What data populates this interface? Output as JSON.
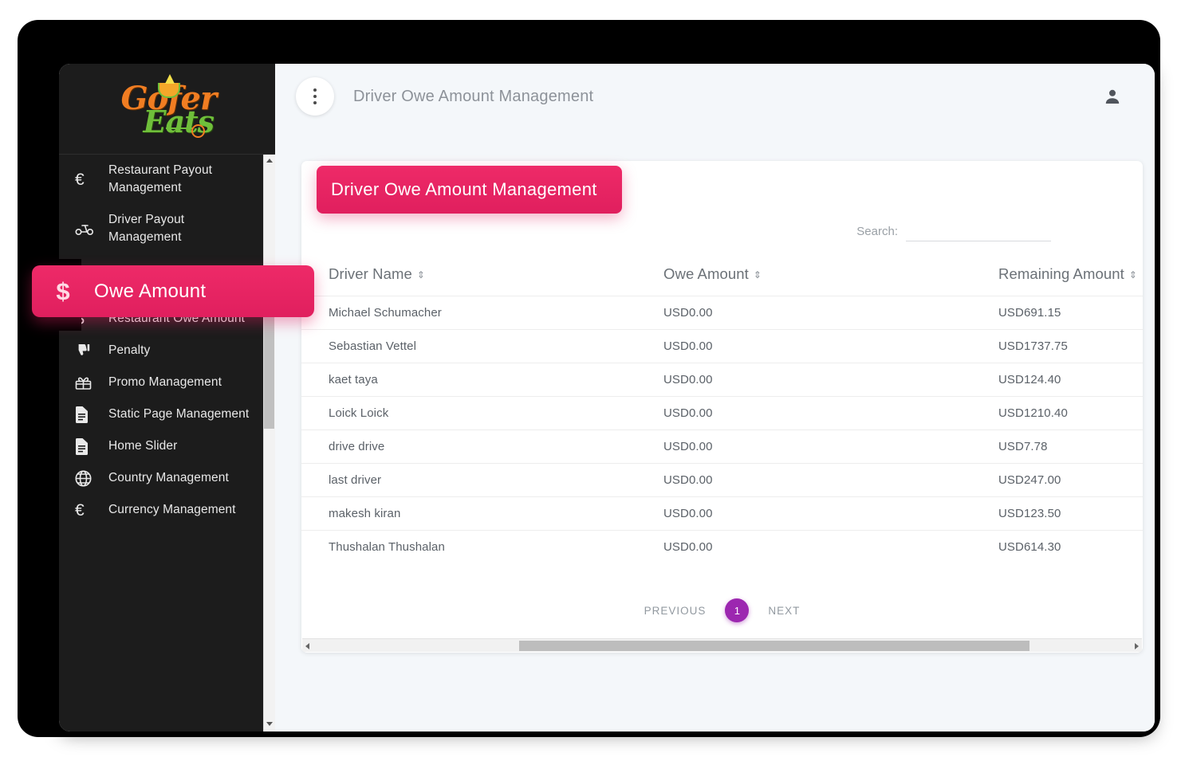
{
  "brand": {
    "logo_primary": "Gofer",
    "logo_secondary": "Eats",
    "accent_pink": "#e81f5e",
    "accent_purple": "#9c27b0",
    "sidebar_bg": "#1c1c1c"
  },
  "topbar": {
    "menu_icon": "kebab-menu-icon",
    "title": "Driver Owe Amount Management",
    "user_icon": "user-account-icon"
  },
  "sidebar": {
    "items": [
      {
        "icon": "euro-icon",
        "label": "Restaurant Payout Management"
      },
      {
        "icon": "scooter-icon",
        "label": "Driver Payout Management"
      },
      {
        "icon": "dollar-icon",
        "label": "Restaurant Owe Amount"
      },
      {
        "icon": "thumbs-down-icon",
        "label": "Penalty"
      },
      {
        "icon": "gift-icon",
        "label": "Promo Management"
      },
      {
        "icon": "document-icon",
        "label": "Static Page Management"
      },
      {
        "icon": "document-icon",
        "label": "Home Slider"
      },
      {
        "icon": "globe-icon",
        "label": "Country Management"
      },
      {
        "icon": "euro-icon",
        "label": "Currency Management"
      }
    ]
  },
  "highlight": {
    "page_badge": "Driver Owe Amount Management",
    "menu_badge_icon": "dollar-icon",
    "menu_badge_label": "Owe Amount"
  },
  "search": {
    "label": "Search:",
    "value": "",
    "placeholder": ""
  },
  "table": {
    "columns": [
      {
        "label": "Driver Name",
        "sort_icon": "sort-updown-icon"
      },
      {
        "label": "Owe Amount",
        "sort_icon": "sort-updown-icon"
      },
      {
        "label": "Remaining Amount",
        "sort_icon": "sort-updown-icon"
      }
    ],
    "rows": [
      {
        "driver_name": "Michael Schumacher",
        "owe_amount": "USD0.00",
        "remaining_amount": "USD691.15"
      },
      {
        "driver_name": "Sebastian Vettel",
        "owe_amount": "USD0.00",
        "remaining_amount": "USD1737.75"
      },
      {
        "driver_name": "kaet taya",
        "owe_amount": "USD0.00",
        "remaining_amount": "USD124.40"
      },
      {
        "driver_name": "Loick Loick",
        "owe_amount": "USD0.00",
        "remaining_amount": "USD1210.40"
      },
      {
        "driver_name": "drive drive",
        "owe_amount": "USD0.00",
        "remaining_amount": "USD7.78"
      },
      {
        "driver_name": "last driver",
        "owe_amount": "USD0.00",
        "remaining_amount": "USD247.00"
      },
      {
        "driver_name": "makesh kiran",
        "owe_amount": "USD0.00",
        "remaining_amount": "USD123.50"
      },
      {
        "driver_name": "Thushalan Thushalan",
        "owe_amount": "USD0.00",
        "remaining_amount": "USD614.30"
      }
    ]
  },
  "pagination": {
    "previous": "PREVIOUS",
    "current_page": "1",
    "next": "NEXT"
  }
}
